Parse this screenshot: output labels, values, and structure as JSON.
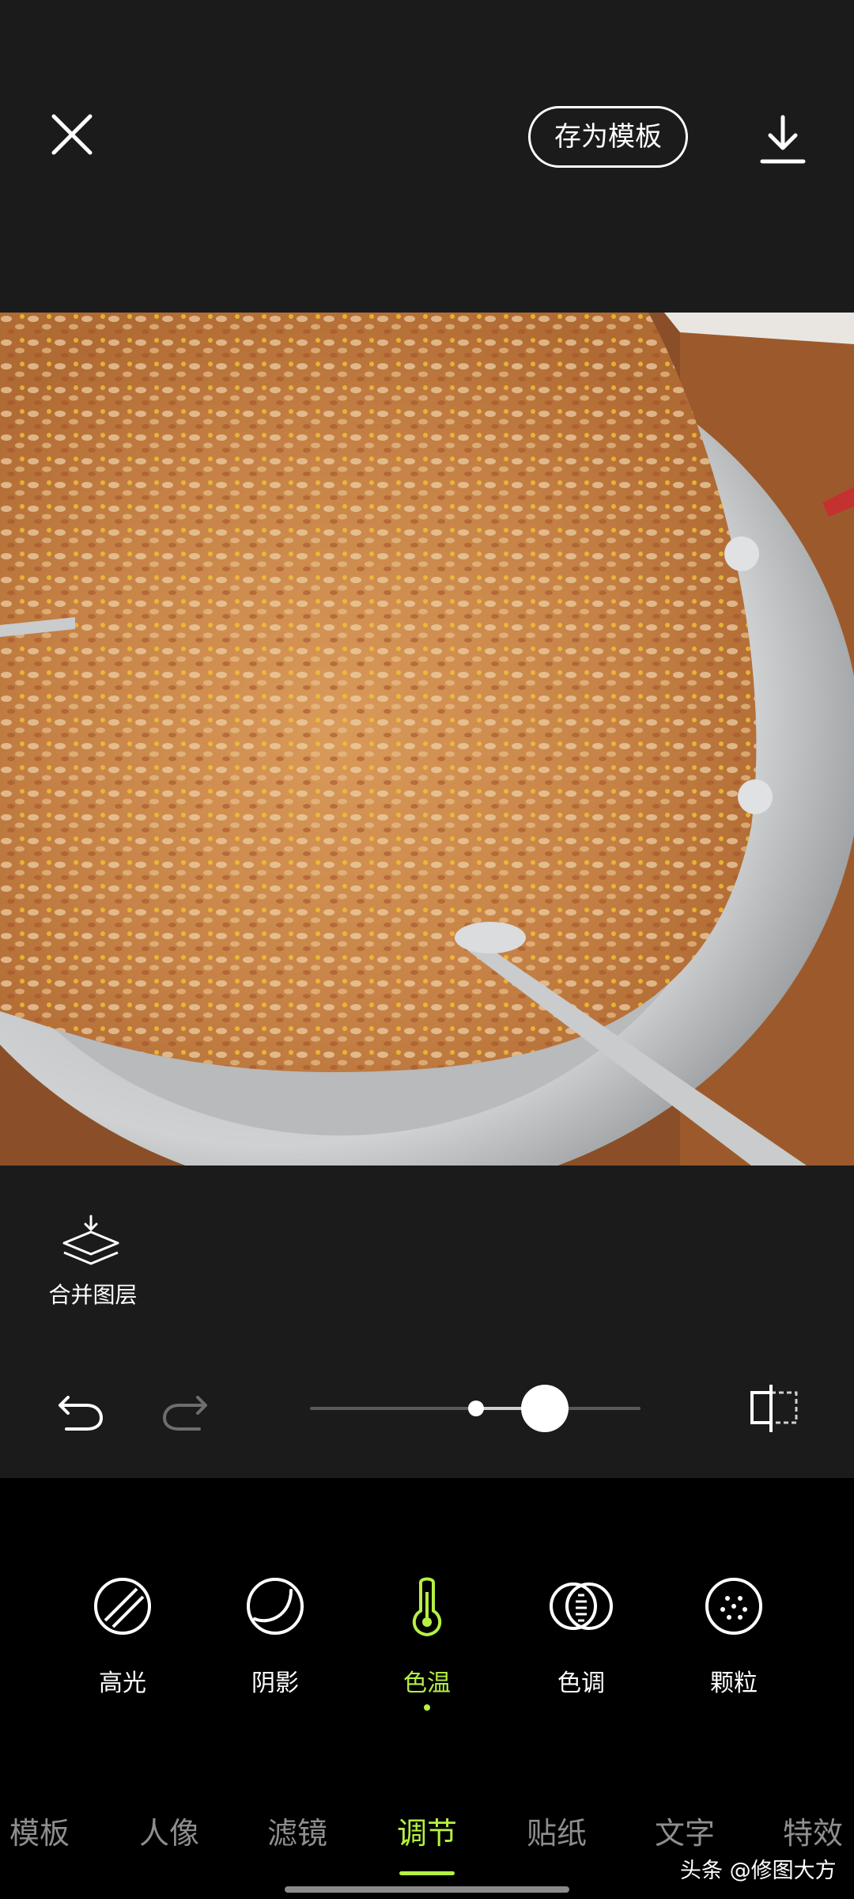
{
  "header": {
    "save_template_label": "存为模板"
  },
  "editor": {
    "merge_layers_label": "合并图层",
    "slider": {
      "value": 0.71
    }
  },
  "tools": [
    {
      "label": "高光",
      "icon": "highlight-icon"
    },
    {
      "label": "阴影",
      "icon": "shadow-icon"
    },
    {
      "label": "色温",
      "icon": "thermometer-icon",
      "active": true
    },
    {
      "label": "色调",
      "icon": "tone-icon"
    },
    {
      "label": "颗粒",
      "icon": "grain-icon"
    }
  ],
  "tabs": [
    {
      "label": "模板"
    },
    {
      "label": "人像"
    },
    {
      "label": "滤镜"
    },
    {
      "label": "调节",
      "active": true
    },
    {
      "label": "贴纸"
    },
    {
      "label": "文字"
    },
    {
      "label": "特效"
    }
  ],
  "watermark": "头条 @修图大方",
  "colors": {
    "accent": "#b6f043",
    "background": "#1b1b1b",
    "panel": "#000000",
    "inactive_tab": "#8e8e8e"
  }
}
